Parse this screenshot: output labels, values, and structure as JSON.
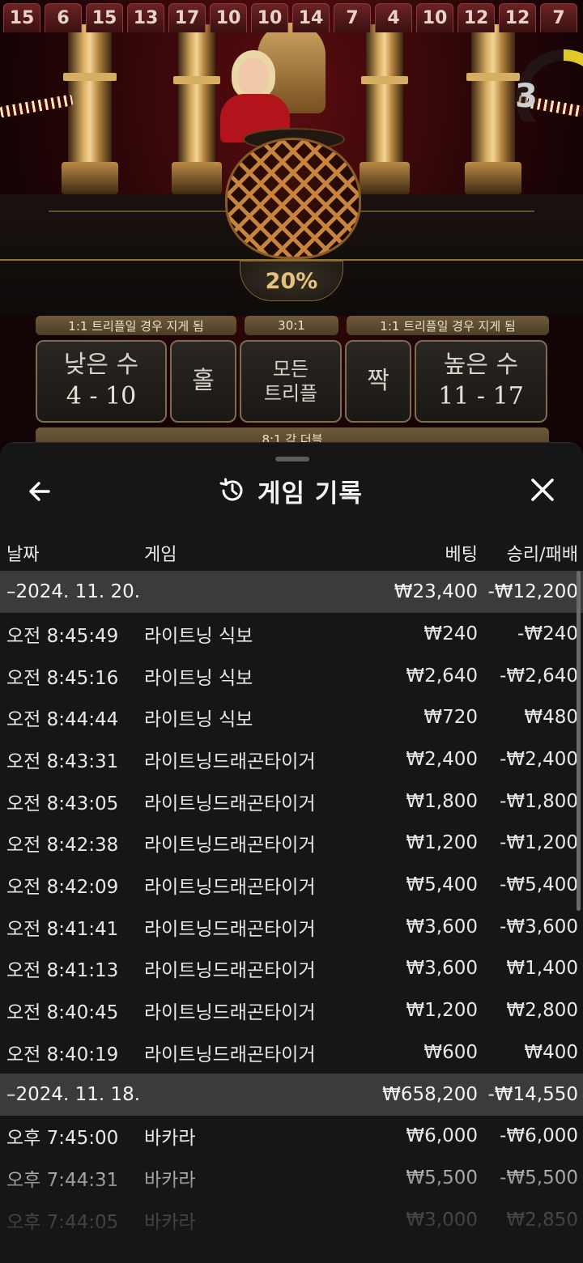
{
  "game": {
    "recent_results": [
      "15",
      "6",
      "15",
      "13",
      "17",
      "10",
      "10",
      "14",
      "7",
      "4",
      "10",
      "12",
      "12",
      "7"
    ],
    "timer_seconds": "3",
    "timer_fraction": 0.25,
    "multiplier_badge": "20%",
    "odds": {
      "left": "1:1 트리플일 경우 지게 됨",
      "center": "30:1",
      "right": "1:1 트리플일 경우 지게 됨",
      "double": "8:1 각 더블"
    },
    "bets": {
      "small_label": "낮은 수",
      "small_range": "4 - 10",
      "odd_label": "홀",
      "any_triple_line1": "모든",
      "any_triple_line2": "트리플",
      "even_label": "짝",
      "big_label": "높은 수",
      "big_range": "11 - 17"
    }
  },
  "sheet": {
    "title": "게임 기록",
    "icons": {
      "back": "arrow-left-icon",
      "history": "history-icon",
      "close": "close-icon"
    },
    "columns": {
      "date": "날짜",
      "game": "게임",
      "bet": "베팅",
      "win_loss": "승리/패배"
    },
    "groups": [
      {
        "date": "–2024. 11. 20.",
        "bet_total": "₩23,400",
        "win_total": "-₩12,200",
        "rows": [
          {
            "time": "오전 8:45:49",
            "game": "라이트닝 식보",
            "bet": "₩240",
            "result": "-₩240"
          },
          {
            "time": "오전 8:45:16",
            "game": "라이트닝 식보",
            "bet": "₩2,640",
            "result": "-₩2,640"
          },
          {
            "time": "오전 8:44:44",
            "game": "라이트닝 식보",
            "bet": "₩720",
            "result": "₩480"
          },
          {
            "time": "오전 8:43:31",
            "game": "라이트닝드래곤타이거",
            "bet": "₩2,400",
            "result": "-₩2,400"
          },
          {
            "time": "오전 8:43:05",
            "game": "라이트닝드래곤타이거",
            "bet": "₩1,800",
            "result": "-₩1,800"
          },
          {
            "time": "오전 8:42:38",
            "game": "라이트닝드래곤타이거",
            "bet": "₩1,200",
            "result": "-₩1,200"
          },
          {
            "time": "오전 8:42:09",
            "game": "라이트닝드래곤타이거",
            "bet": "₩5,400",
            "result": "-₩5,400"
          },
          {
            "time": "오전 8:41:41",
            "game": "라이트닝드래곤타이거",
            "bet": "₩3,600",
            "result": "-₩3,600"
          },
          {
            "time": "오전 8:41:13",
            "game": "라이트닝드래곤타이거",
            "bet": "₩3,600",
            "result": "₩1,400"
          },
          {
            "time": "오전 8:40:45",
            "game": "라이트닝드래곤타이거",
            "bet": "₩1,200",
            "result": "₩2,800"
          },
          {
            "time": "오전 8:40:19",
            "game": "라이트닝드래곤타이거",
            "bet": "₩600",
            "result": "₩400"
          }
        ]
      },
      {
        "date": "–2024. 11. 18.",
        "bet_total": "₩658,200",
        "win_total": "-₩14,550",
        "rows": [
          {
            "time": "오후 7:45:00",
            "game": "바카라",
            "bet": "₩6,000",
            "result": "-₩6,000"
          },
          {
            "time": "오후 7:44:31",
            "game": "바카라",
            "bet": "₩5,500",
            "result": "-₩5,500"
          },
          {
            "time": "오후 7:44:05",
            "game": "바카라",
            "bet": "₩3,000",
            "result": "₩2,850"
          }
        ]
      }
    ]
  }
}
